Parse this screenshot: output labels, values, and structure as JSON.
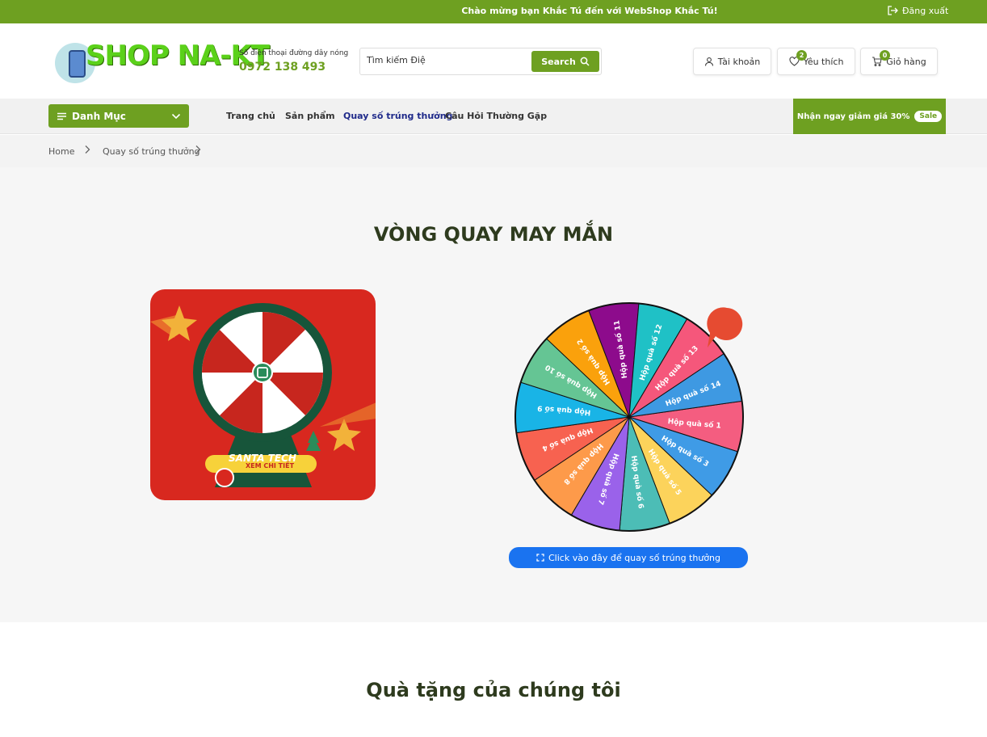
{
  "topbar": {
    "welcome": "Chào mừng bạn Khắc Tú đến với WebShop Khắc Tú!",
    "logout": "Đăng xuất",
    "logout_icon": "logout-icon"
  },
  "header": {
    "logo": "SHOP NA-KT",
    "hotline_label": "Số điện thoại đường dây nóng",
    "hotline_number": "0972 138 493",
    "search_value": "Tìm kiếm Điệ",
    "search_button": "Search",
    "account": "Tài khoản",
    "wishlist": "Yêu thích",
    "wishlist_count": "2",
    "cart": "Giỏ hàng",
    "cart_count": "0"
  },
  "nav": {
    "category_button": "Danh Mục",
    "items": [
      {
        "label": "Trang chủ"
      },
      {
        "label": "Sản phẩm"
      },
      {
        "label": "Quay số trúng thưởng"
      },
      {
        "label": "Câu Hỏi Thường Gặp"
      }
    ],
    "promo": "Nhận ngay giảm giá 30%",
    "promo_badge": "Sale"
  },
  "breadcrumb": {
    "home": "Home",
    "current": "Quay số trúng thưởng"
  },
  "lucky": {
    "title": "VÒNG QUAY MAY MẮN",
    "card": {
      "brand": "SANTA TECH",
      "cta": "XEM CHI TIẾT"
    },
    "wheel_segments": [
      {
        "label": "Hộp quà số 1",
        "color": "#f45d80"
      },
      {
        "label": "Hộp quà số 3",
        "color": "#3f9be6"
      },
      {
        "label": "Hộp quà số 5",
        "color": "#fcd35b"
      },
      {
        "label": "Hộp quà số 6",
        "color": "#4cbdb6"
      },
      {
        "label": "Hộp quà số 7",
        "color": "#9a62ea"
      },
      {
        "label": "Hộp quà số 8",
        "color": "#fd9a4a"
      },
      {
        "label": "Hộp quà số 4",
        "color": "#f76250"
      },
      {
        "label": "Hộp quà số 9",
        "color": "#19b4e6"
      },
      {
        "label": "Hộp quà số 10",
        "color": "#65c594"
      },
      {
        "label": "Hộp quà số 2",
        "color": "#faa10c"
      },
      {
        "label": "Hộp quà số 11",
        "color": "#8d0b8c"
      },
      {
        "label": "Hộp quà số 12",
        "color": "#1fc1c6"
      },
      {
        "label": "Hộp quà số 13",
        "color": "#f5577b"
      },
      {
        "label": "Hộp quà số 14",
        "color": "#3e99e2"
      }
    ],
    "spin_button": "Click vào đây để quay số trúng thưởng"
  },
  "gifts": {
    "title": "Quà tặng của chúng tôi"
  }
}
